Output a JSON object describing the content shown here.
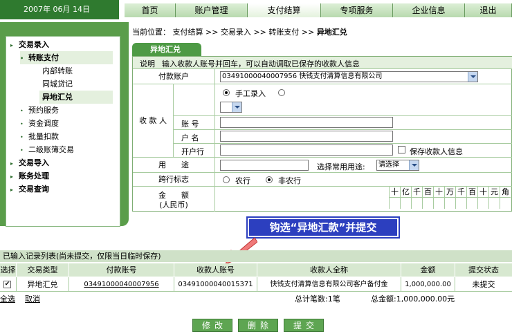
{
  "date": "2007年 06月 14日",
  "nav": [
    "首页",
    "账户管理",
    "支付结算",
    "专项服务",
    "企业信息",
    "退出"
  ],
  "sidebar": {
    "items": [
      {
        "label": "交易录入",
        "marker": "▸"
      },
      {
        "label": "转账支付",
        "marker": "•"
      },
      {
        "label": "内部转账",
        "marker": ""
      },
      {
        "label": "同城贷记",
        "marker": ""
      },
      {
        "label": "异地汇兑",
        "marker": ""
      },
      {
        "label": "预约服务",
        "marker": "•"
      },
      {
        "label": "资金调度",
        "marker": "•"
      },
      {
        "label": "批量扣款",
        "marker": "•"
      },
      {
        "label": "二级账簿交易",
        "marker": "•"
      },
      {
        "label": "交易导入",
        "marker": "▸"
      },
      {
        "label": "账务处理",
        "marker": "▸"
      },
      {
        "label": "交易查询",
        "marker": "▸"
      }
    ]
  },
  "breadcrumb": {
    "prefix": "当前位置：",
    "path": [
      "支付结算",
      ">>",
      "交易录入",
      ">>",
      "转账支付",
      ">>"
    ],
    "current": "异地汇兑"
  },
  "form": {
    "tab_label": "异地汇兑",
    "note_label": "说明",
    "note_text": "输入收款人账号并回车，可以自动调取已保存的收款人信息",
    "payer_label": "付款账户",
    "payer_value": "03491000040007956 快钱支付清算信息有限公司",
    "payee_label": "收 款 人",
    "manual_entry": "手工录入",
    "acct_label": "账 号",
    "name_label": "户 名",
    "bank_label": "开户行",
    "save_payee": "保存收款人信息",
    "purpose_label": "用　　途",
    "purpose_select_label": "选择常用用途:",
    "purpose_select_value": "请选择",
    "crossbank_label": "跨行标志",
    "crossbank_opt1": "农行",
    "crossbank_opt2": "非农行",
    "amount_label": "金　　额",
    "amount_sub": "(人民币)",
    "amount_units": [
      "十",
      "亿",
      "千",
      "百",
      "十",
      "万",
      "千",
      "百",
      "十",
      "元",
      "角"
    ]
  },
  "callout": "钩选“异地汇款”并提交",
  "list": {
    "title": "已输入记录列表(尚未提交，仅限当日临时保存)",
    "headers": [
      "选择",
      "交易类型",
      "付款账号",
      "收款人账号",
      "收款人全称",
      "金额",
      "提交状态"
    ],
    "rows": [
      {
        "check": "✔",
        "type": "异地汇兑",
        "payer": "03491000040007956",
        "payee_acct": "03491000040015371",
        "payee_name": "快钱支付清算信息有限公司客户备付金",
        "amount": "1,000,000.00",
        "status": "未提交"
      }
    ],
    "select_all": "全选",
    "cancel": "取消",
    "total_count": "总计笔数:1笔",
    "total_amount": "总金额:1,000,000.00元"
  },
  "buttons": {
    "modify": "修改",
    "delete": "删除",
    "submit": "提交"
  }
}
